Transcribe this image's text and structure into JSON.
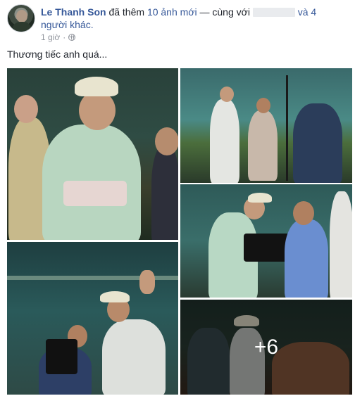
{
  "post": {
    "author": "Le Thanh Son",
    "action_prefix": "đã thêm",
    "added_photos": "10 ảnh mới",
    "with_text": "— cùng với",
    "and_others": "và 4 người khác.",
    "time": "1 giờ",
    "privacy_icon": "globe-icon",
    "caption": "Thương tiếc anh quá...",
    "more_photos": "+6"
  },
  "colors": {
    "link": "#365899",
    "meta": "#90949c",
    "text": "#1d2129"
  }
}
